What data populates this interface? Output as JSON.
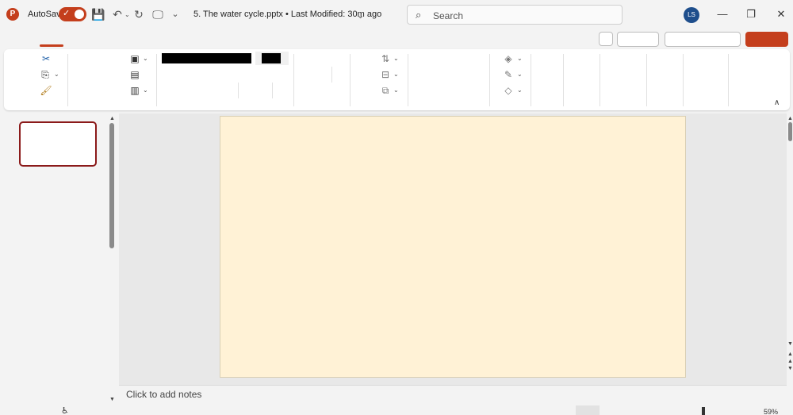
{
  "titlebar": {
    "app_logo": "P",
    "autosave_label": "AutoSave",
    "autosave_on": true,
    "doc_title": "5. The water cycle.pptx • Last Modified: 30m ago",
    "search_placeholder": "Search",
    "user_initials": "LS",
    "icons": {
      "save": "💾",
      "undo": "↶",
      "redo": "↻",
      "present": "🖵",
      "minimize": "—",
      "restore": "❐",
      "close": "✕",
      "search": "⌕",
      "title_chevron": "⌄"
    }
  },
  "ribbon": {
    "icons": {
      "cut": "✂",
      "copy": "⎘",
      "format_painter": "🖌",
      "new_slide": "▣",
      "layout": "▤",
      "section": "▥",
      "text_direction": "⇅",
      "align_text": "⊟",
      "convert_smartart": "⧉",
      "shape_fill": "◈",
      "shape_outline": "✎",
      "shape_effects": "◇",
      "caret": "⌄",
      "collapse": "∧"
    }
  },
  "notes": {
    "placeholder": "Click to add notes"
  },
  "statusbar": {
    "accessibility_icon": "♿",
    "zoom": "59%"
  },
  "colors": {
    "accent": "#c43e1c",
    "slide_background": "#fff2d6",
    "thumbnail_border": "#8b1a1a",
    "avatar": "#1e4e8c"
  }
}
